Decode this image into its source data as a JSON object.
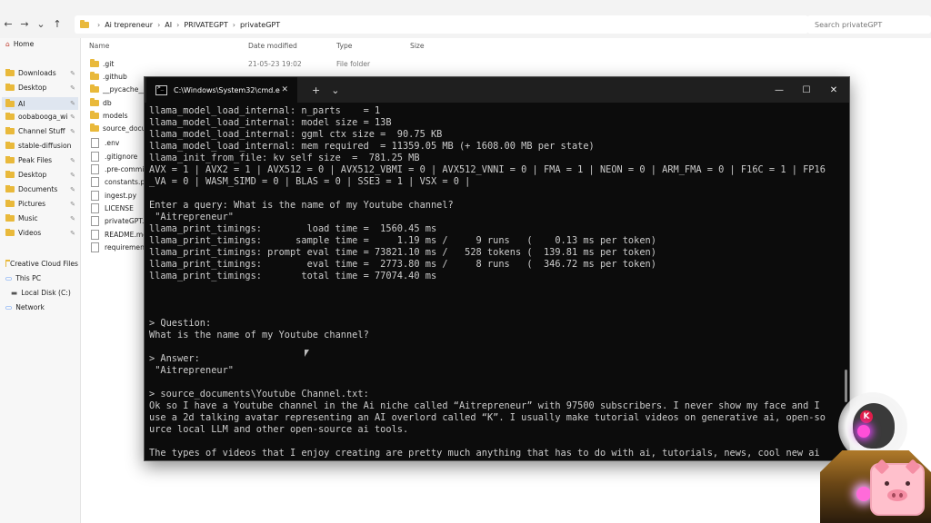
{
  "explorer": {
    "nav": {
      "back": "←",
      "forward": "→",
      "recent": "⌄",
      "up": "↑"
    },
    "breadcrumb": [
      "Ai trepreneur",
      "AI",
      "PRIVATEGPT",
      "privateGPT"
    ],
    "breadcrumb_sep": "›",
    "search_placeholder": "Search privateGPT",
    "columns": {
      "name": "Name",
      "date": "Date modified",
      "type": "Type",
      "size": "Size"
    },
    "sidebar": {
      "home": "Home",
      "quick": [
        "Downloads",
        "Desktop",
        "AI",
        "oobabooga_wi",
        "Channel Stuff",
        "stable-diffusion",
        "Peak Files",
        "Desktop",
        "Documents",
        "Pictures",
        "Music",
        "Videos"
      ],
      "cloud": "Creative Cloud Files",
      "this_pc": "This PC",
      "local_disk": "Local Disk (C:)",
      "network": "Network"
    },
    "files": [
      {
        "name": ".git",
        "kind": "folder",
        "date": "21-05-23 19:02",
        "type": "File folder"
      },
      {
        "name": ".github",
        "kind": "folder"
      },
      {
        "name": "__pycache__",
        "kind": "folder"
      },
      {
        "name": "db",
        "kind": "folder"
      },
      {
        "name": "models",
        "kind": "folder"
      },
      {
        "name": "source_documents",
        "kind": "folder"
      },
      {
        "name": ".env",
        "kind": "file"
      },
      {
        "name": ".gitignore",
        "kind": "file"
      },
      {
        "name": ".pre-commit-config",
        "kind": "file"
      },
      {
        "name": "constants.py",
        "kind": "file"
      },
      {
        "name": "ingest.py",
        "kind": "file"
      },
      {
        "name": "LICENSE",
        "kind": "file"
      },
      {
        "name": "privateGPT.py",
        "kind": "file"
      },
      {
        "name": "README.md",
        "kind": "file"
      },
      {
        "name": "requirements.txt",
        "kind": "file"
      }
    ]
  },
  "terminal": {
    "tab_title": "C:\\Windows\\System32\\cmd.e",
    "tab_close": "✕",
    "new_tab": "+",
    "dropdown": "⌄",
    "minimize": "—",
    "maximize": "☐",
    "close": "✕",
    "lines": [
      "llama_model_load_internal: n_parts    = 1",
      "llama_model_load_internal: model size = 13B",
      "llama_model_load_internal: ggml ctx size =  90.75 KB",
      "llama_model_load_internal: mem required  = 11359.05 MB (+ 1608.00 MB per state)",
      "llama_init_from_file: kv self size  =  781.25 MB",
      "AVX = 1 | AVX2 = 1 | AVX512 = 0 | AVX512_VBMI = 0 | AVX512_VNNI = 0 | FMA = 1 | NEON = 0 | ARM_FMA = 0 | F16C = 1 | FP16",
      "_VA = 0 | WASM_SIMD = 0 | BLAS = 0 | SSE3 = 1 | VSX = 0 |",
      "",
      "Enter a query: What is the name of my Youtube channel?",
      " \"Aitrepreneur\"",
      "llama_print_timings:        load time =  1560.45 ms",
      "llama_print_timings:      sample time =     1.19 ms /     9 runs   (    0.13 ms per token)",
      "llama_print_timings: prompt eval time = 73821.10 ms /   528 tokens (  139.81 ms per token)",
      "llama_print_timings:        eval time =  2773.80 ms /     8 runs   (  346.72 ms per token)",
      "llama_print_timings:       total time = 77074.40 ms",
      "",
      "",
      "",
      "> Question:",
      "What is the name of my Youtube channel?",
      "",
      "> Answer:",
      " \"Aitrepreneur\"",
      "",
      "> source_documents\\Youtube Channel.txt:",
      "Ok so I have a Youtube channel in the Ai niche called “Aitrepreneur” with 97500 subscribers. I never show my face and I",
      "use a 2d talking avatar representing an AI overlord called “K”. I usually make tutorial videos on generative ai, open-so",
      "urce local LLM and other open-source ai tools.",
      "",
      "The types of videos that I enjoy creating are pretty much anything that has to do with ai, tutorials, news, cool new ai"
    ]
  },
  "avatar": {
    "badge": "K"
  }
}
